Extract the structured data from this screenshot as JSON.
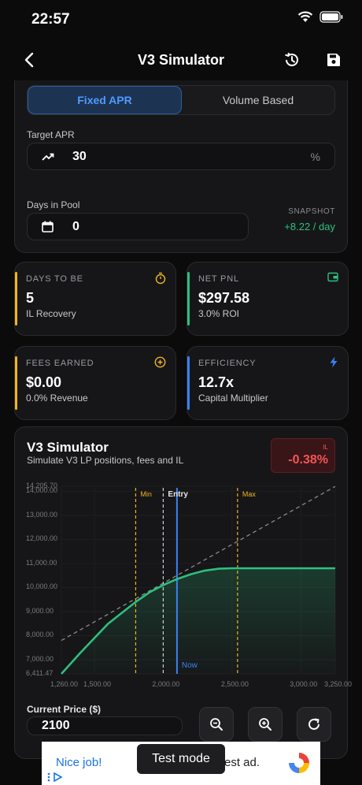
{
  "status_bar": {
    "time": "22:57"
  },
  "nav": {
    "title": "V3 Simulator"
  },
  "mode_selector": {
    "options": [
      "Fixed APR",
      "Volume Based"
    ],
    "selected": "Fixed APR"
  },
  "target_apr": {
    "label": "Target APR",
    "value": "30",
    "unit": "%"
  },
  "days_in_pool": {
    "label": "Days in Pool",
    "value": "0"
  },
  "snapshot": {
    "label": "SNAPSHOT",
    "value": "+8.22 / day",
    "color": "#2fbf7f"
  },
  "stats": [
    {
      "title": "DAYS TO BE",
      "value": "5",
      "subtitle": "IL Recovery",
      "accent": "#f0b423",
      "icon": "stopwatch-icon"
    },
    {
      "title": "NET PNL",
      "value": "$297.58",
      "subtitle": "3.0% ROI",
      "accent": "#2fbf7f",
      "icon": "wallet-icon"
    },
    {
      "title": "FEES EARNED",
      "value": "$0.00",
      "subtitle": "0.0% Revenue",
      "accent": "#f0b423",
      "icon": "plus-circle-icon"
    },
    {
      "title": "EFFICIENCY",
      "value": "12.7x",
      "subtitle": "Capital Multiplier",
      "accent": "#3b82f6",
      "icon": "bolt-icon"
    }
  ],
  "simulator": {
    "title": "V3 Simulator",
    "subtitle": "Simulate V3 LP positions, fees and IL",
    "il_label": "IL",
    "il_value": "-0.38%",
    "il_color": "#f25555"
  },
  "chart_data": {
    "type": "line",
    "xlim": [
      1260,
      3250
    ],
    "ylim": [
      6411.47,
      14205.7
    ],
    "x_ticks": [
      "1,260.00",
      "1,500.00",
      "2,000.00",
      "2,500.00",
      "3,000.00",
      "3,250.00"
    ],
    "x_tick_values": [
      1260,
      1500,
      2000,
      2500,
      3000,
      3250
    ],
    "y_ticks": [
      "6,411.47",
      "7,000.00",
      "8,000.00",
      "9,000.00",
      "10,000.00",
      "11,000.00",
      "12,000.00",
      "13,000.00",
      "14,000.00",
      "14,205.70"
    ],
    "y_tick_values": [
      6411.47,
      7000,
      8000,
      9000,
      10000,
      11000,
      12000,
      13000,
      14000,
      14205.7
    ],
    "range_lines": [
      {
        "label": "Min",
        "x": 1800,
        "color": "#f0b423"
      },
      {
        "label": "Entry",
        "x": 2000,
        "color": "#cfcfd2"
      },
      {
        "label": "Max",
        "x": 2540,
        "color": "#f0b423"
      }
    ],
    "now_line": {
      "label": "Now",
      "x": 2100,
      "color": "#3b82f6"
    },
    "series": [
      {
        "type": "hold",
        "color": "#8a8a8e",
        "x": [
          1260,
          3250
        ],
        "y": [
          7800,
          14200
        ]
      },
      {
        "type": "lp",
        "color": "#2fbf7f",
        "x": [
          1260,
          1400,
          1600,
          1800,
          1900,
          2000,
          2100,
          2200,
          2300,
          2400,
          2500,
          2540,
          2700,
          3000,
          3250
        ],
        "y": [
          6411.47,
          7300,
          8500,
          9400,
          9800,
          10100,
          10350,
          10550,
          10700,
          10780,
          10800,
          10800,
          10800,
          10800,
          10800
        ]
      }
    ]
  },
  "current_price": {
    "label": "Current Price ($)",
    "value": "2100"
  },
  "ad": {
    "left_text": "Nice job!",
    "right_text": "est ad.",
    "toast": "Test mode"
  }
}
